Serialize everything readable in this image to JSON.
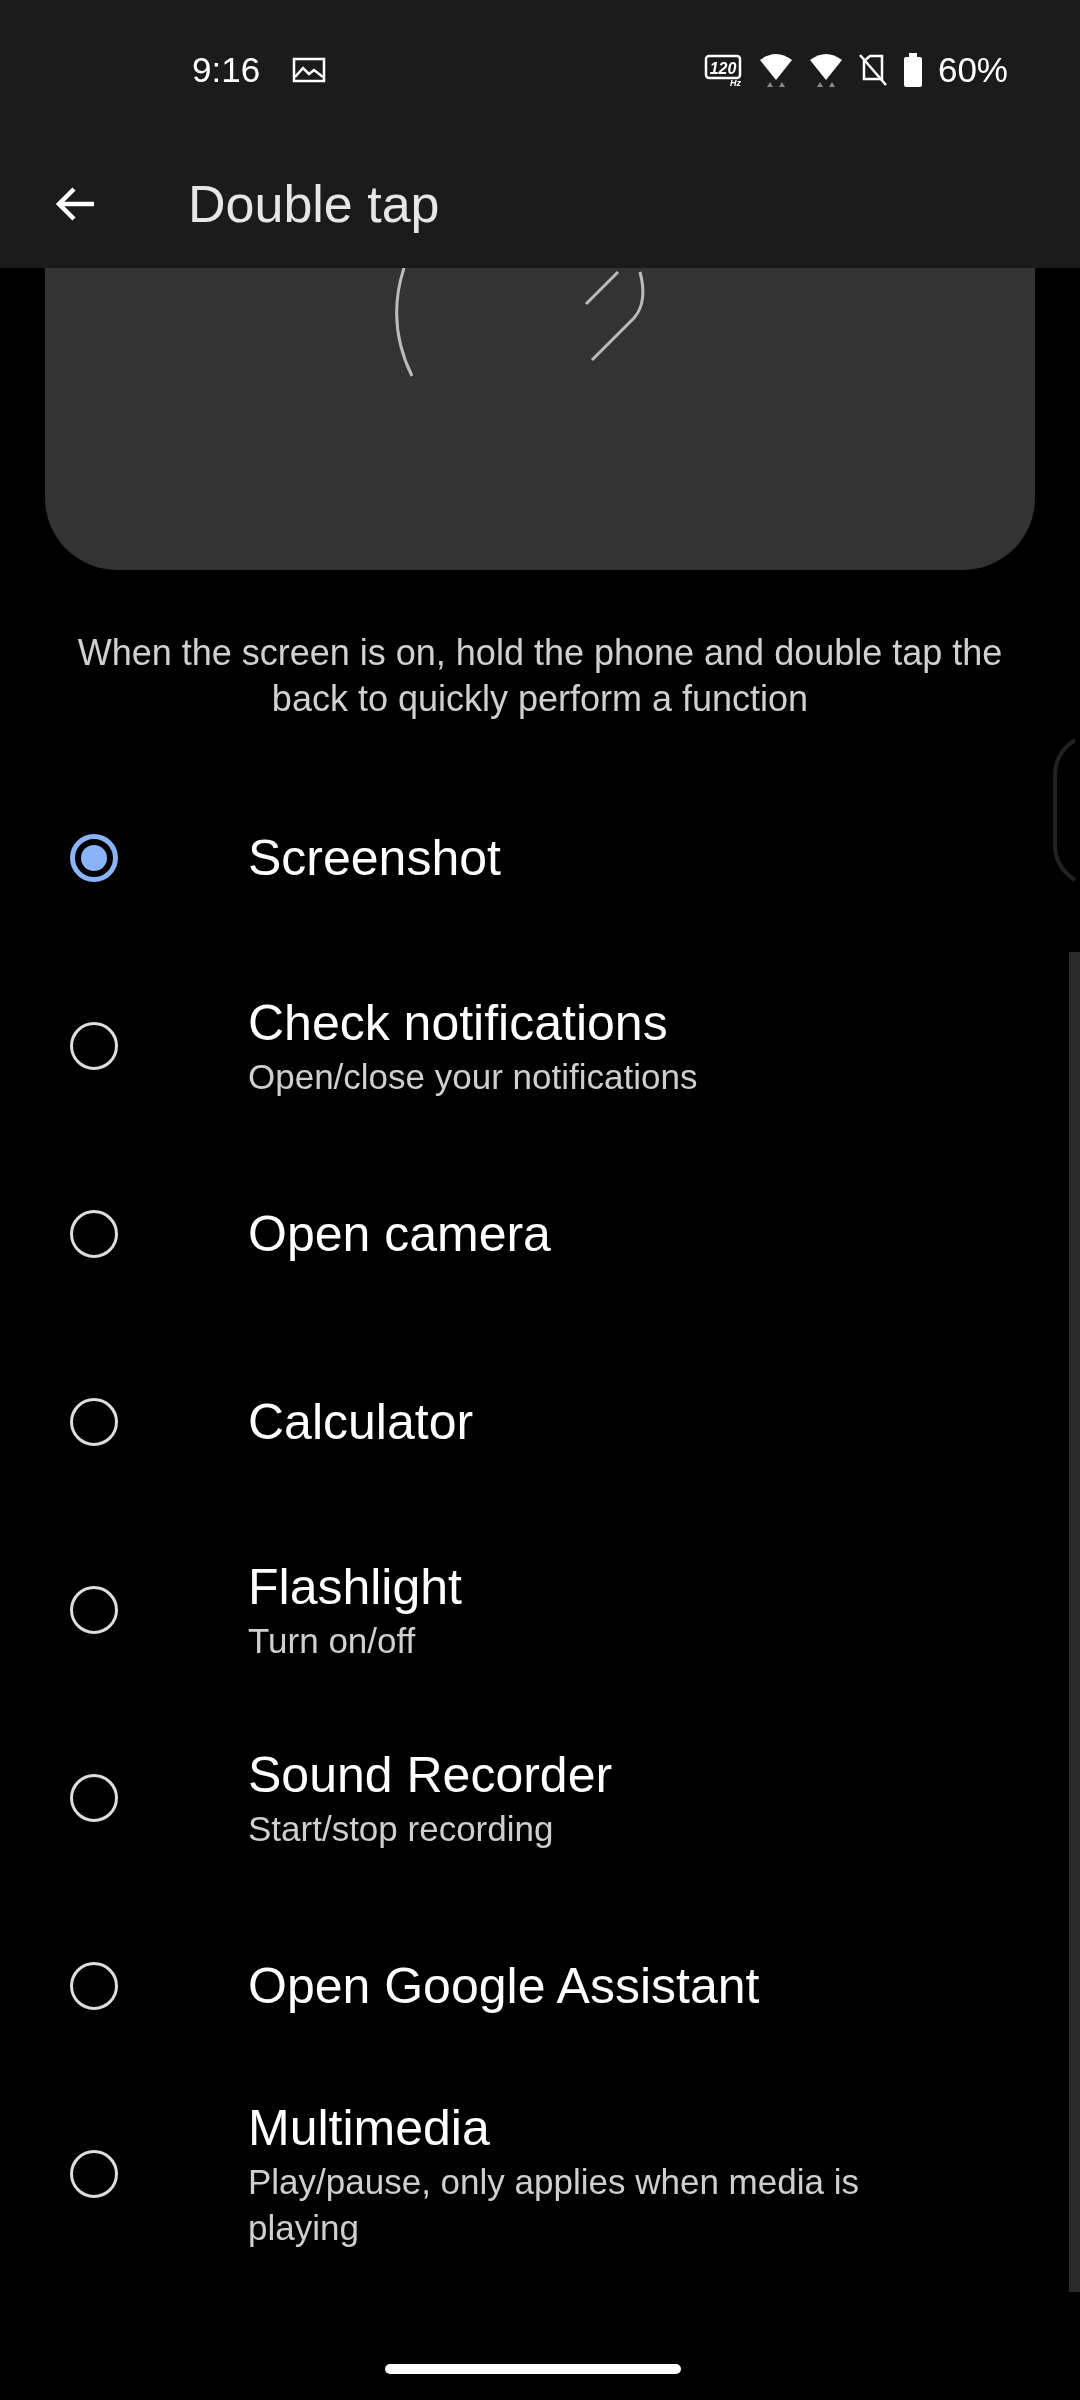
{
  "status_bar": {
    "time": "9:16",
    "refresh_rate": "120",
    "refresh_unit": "Hz",
    "battery": "60%"
  },
  "app_bar": {
    "title": "Double tap"
  },
  "description": "When the screen is on, hold the phone and double tap the back to quickly perform a function",
  "options": [
    {
      "title": "Screenshot",
      "selected": true
    },
    {
      "title": "Check notifications",
      "subtitle": "Open/close your notifications",
      "selected": false
    },
    {
      "title": "Open camera",
      "selected": false
    },
    {
      "title": "Calculator",
      "selected": false
    },
    {
      "title": "Flashlight",
      "subtitle": "Turn on/off",
      "selected": false
    },
    {
      "title": "Sound Recorder",
      "subtitle": "Start/stop recording",
      "selected": false
    },
    {
      "title": "Open Google Assistant",
      "selected": false
    },
    {
      "title": "Multimedia",
      "subtitle": "Play/pause, only applies when media is playing",
      "selected": false
    }
  ]
}
